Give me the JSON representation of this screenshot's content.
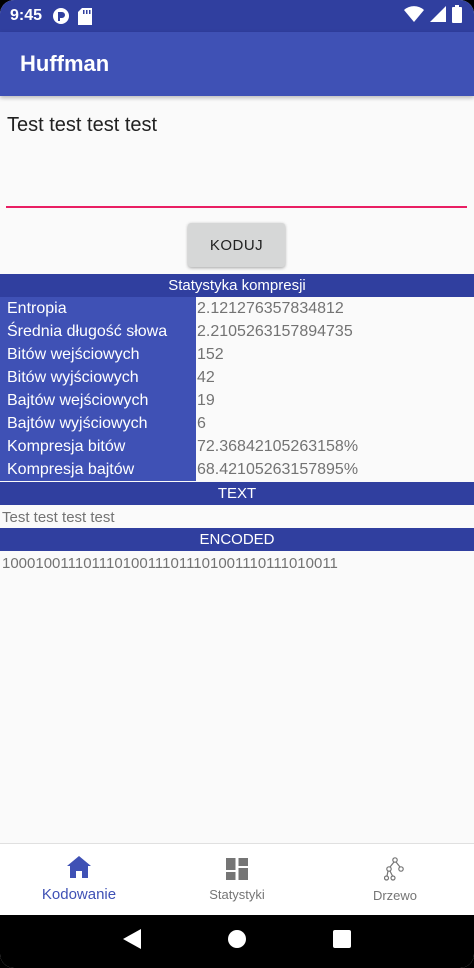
{
  "status_bar": {
    "time": "9:45"
  },
  "app_bar": {
    "title": "Huffman"
  },
  "input": {
    "value": "Test test test test"
  },
  "code_button": {
    "label": "KODUJ"
  },
  "stats": {
    "header": "Statystyka kompresji",
    "rows": [
      {
        "label": "Entropia",
        "value": "2.121276357834812"
      },
      {
        "label": "Średnia długość słowa",
        "value": "2.2105263157894735"
      },
      {
        "label": "Bitów wejściowych",
        "value": "152"
      },
      {
        "label": "Bitów wyjściowych",
        "value": "42"
      },
      {
        "label": "Bajtów wejściowych",
        "value": "19"
      },
      {
        "label": "Bajtów wyjściowych",
        "value": "6"
      },
      {
        "label": "Kompresja bitów",
        "value": "72.36842105263158%"
      },
      {
        "label": "Kompresja bajtów",
        "value": "68.42105263157895%"
      }
    ]
  },
  "text_section": {
    "header": "TEXT",
    "content": "Test test test test"
  },
  "encoded_section": {
    "header": "ENCODED",
    "content": "100010011101110100111011101001110111010011"
  },
  "bottom_nav": {
    "items": [
      {
        "label": "Kodowanie",
        "icon": "home-icon",
        "active": true
      },
      {
        "label": "Statystyki",
        "icon": "dashboard-icon",
        "active": false
      },
      {
        "label": "Drzewo",
        "icon": "tree-icon",
        "active": false
      }
    ]
  },
  "colors": {
    "primary": "#3f51b5",
    "primary_dark": "#303f9f",
    "accent": "#e91e63"
  }
}
